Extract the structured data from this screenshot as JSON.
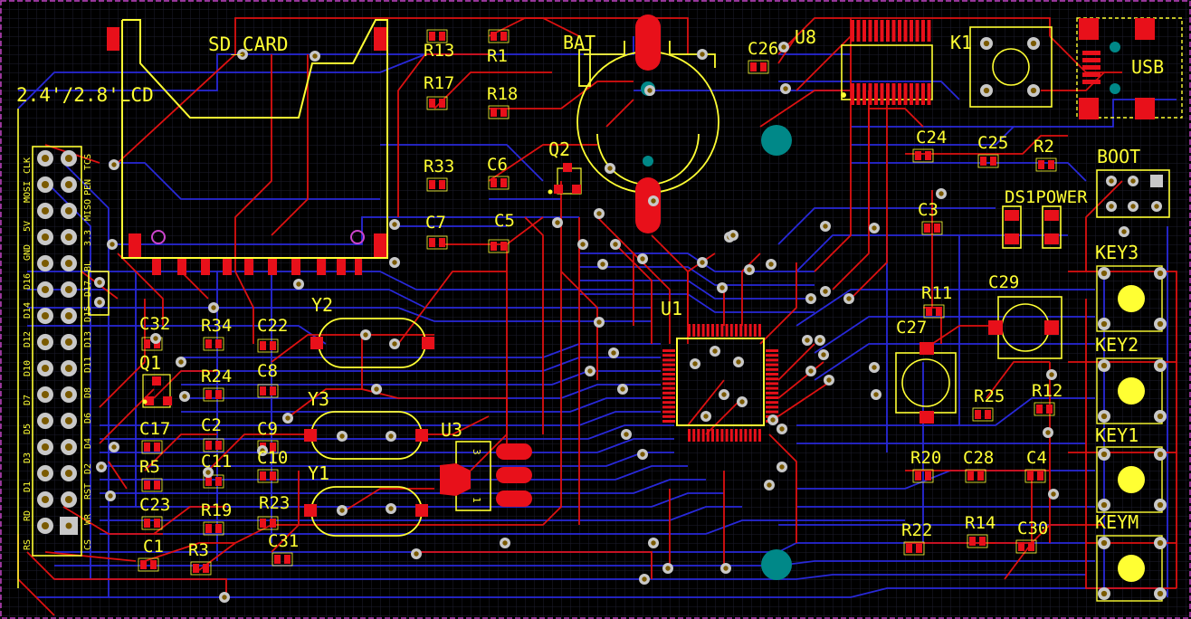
{
  "board": {
    "colors": {
      "background": "#000000",
      "grid": "#1e1e2e",
      "outline": "#c040c0",
      "top_copper": "#dd1111",
      "bottom_copper": "#2828d8",
      "silkscreen": "#ffff33",
      "pad": "#e8101a",
      "via_ring": "#c8c8c8",
      "via_hole": "#7a5a00",
      "mounting_hole": "#008888"
    }
  },
  "labels": {
    "sd_card": "SD_CARD",
    "lcd": "2.4'/2.8'LCD",
    "bat": "BAT",
    "usb": "USB",
    "boot": "BOOT",
    "power": "DS1POWER",
    "k1": "K1",
    "u1": "U1",
    "u3": "U3",
    "u8": "U8",
    "q1": "Q1",
    "q2": "Q2",
    "y1": "Y1",
    "y2": "Y2",
    "y3": "Y3",
    "key3": "KEY3",
    "key2": "KEY2",
    "key1": "KEY1",
    "keym": "KEYM",
    "r13": "R13",
    "r1": "R1",
    "r17": "R17",
    "r18": "R18",
    "r33": "R33",
    "c6": "C6",
    "c7": "C7",
    "c5": "C5",
    "c26": "C26",
    "c24": "C24",
    "c25": "C25",
    "r2": "R2",
    "c3": "C3",
    "r11": "R11",
    "c29": "C29",
    "c27": "C27",
    "r25": "R25",
    "r12": "R12",
    "r20": "R20",
    "c28": "C28",
    "c4": "C4",
    "r22": "R22",
    "r14": "R14",
    "c30": "C30",
    "c32": "C32",
    "r34": "R34",
    "c22": "C22",
    "r24": "R24",
    "c8": "C8",
    "c17": "C17",
    "c2": "C2",
    "c9": "C9",
    "r5": "R5",
    "c11": "C11",
    "c10": "C10",
    "c23": "C23",
    "r19": "R19",
    "r23": "R23",
    "c31": "C31",
    "c1": "C1",
    "r3": "R3"
  },
  "lcd_pins": {
    "left": [
      "RS",
      "RD",
      "D1",
      "D3",
      "D5",
      "D7",
      "D10",
      "D12",
      "D14",
      "D16",
      "GND",
      "5V",
      "MOSI",
      "CLK"
    ],
    "right": [
      "CS",
      "WR",
      "RST",
      "D2",
      "D4",
      "D6",
      "D8",
      "D11",
      "D13",
      "D15",
      "D17",
      "BL",
      "3.3",
      "MISO",
      "PEN",
      "TCS"
    ],
    "left_extra": [
      "3.3",
      "GND",
      "MO"
    ]
  },
  "u3_pin_labels": [
    "3",
    "1"
  ]
}
